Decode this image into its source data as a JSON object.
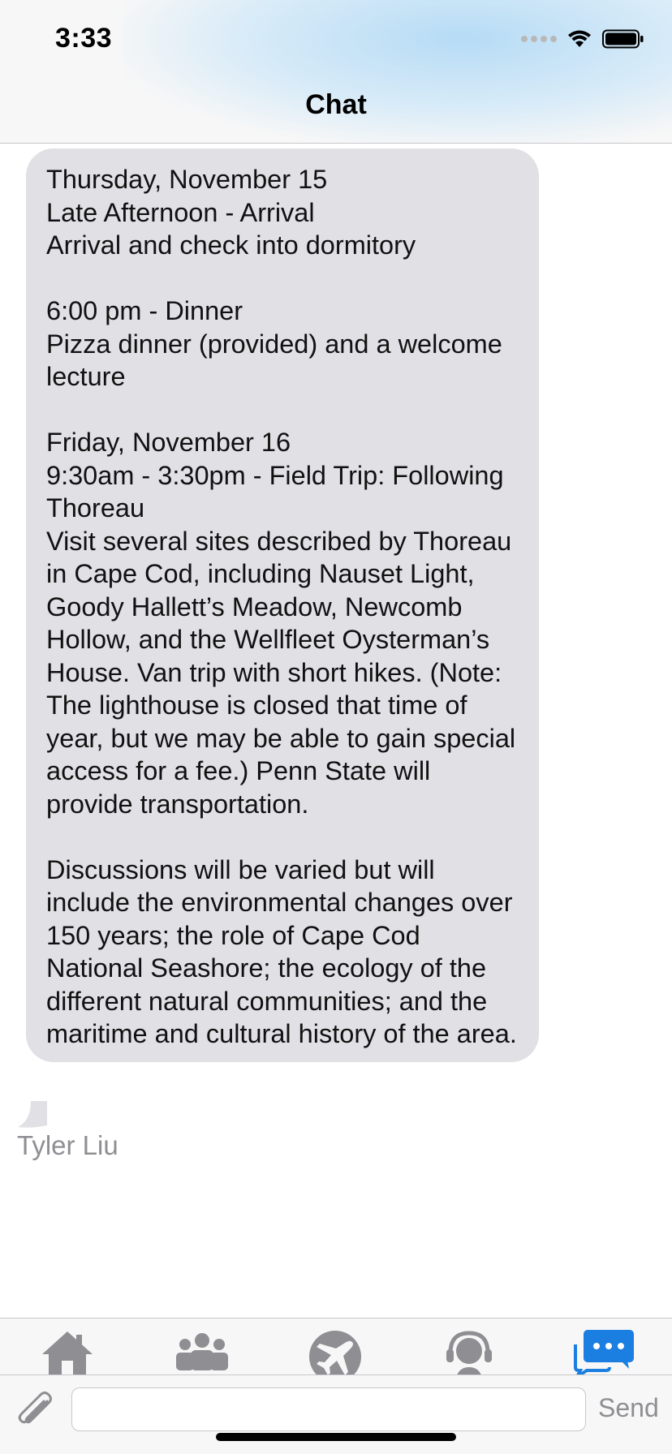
{
  "status_bar": {
    "time": "3:33"
  },
  "nav": {
    "title": "Chat"
  },
  "message": {
    "text": "Thursday, November 15\nLate Afternoon - Arrival\nArrival and check into dormitory\n\n6:00 pm - Dinner\nPizza dinner (provided) and a welcome lecture\n\nFriday, November 16\n9:30am - 3:30pm - Field Trip: Following Thoreau\nVisit several sites described by Thoreau in Cape Cod, including Nauset Light, Goody Hallett’s Meadow, Newcomb Hollow, and the Wellfleet Oysterman’s House. Van trip with short hikes. (Note: The lighthouse is closed that time of year, but we may be able to gain special access for a fee.) Penn State will provide transportation.\n\nDiscussions will be varied but will include the environmental changes over 150 years; the role of Cape Cod National Seashore; the ecology of the different natural communities; and the maritime and cultural history of the area.",
    "sender": "Tyler Liu"
  },
  "tabbar": {
    "tabs": [
      {
        "icon": "home-icon",
        "active": false
      },
      {
        "icon": "people-icon",
        "active": false
      },
      {
        "icon": "airplane-icon",
        "active": false
      },
      {
        "icon": "support-headset-icon",
        "active": false
      },
      {
        "icon": "chat-icon",
        "active": true
      }
    ],
    "active_color": "#1a7fe0",
    "inactive_color": "#8e8e93"
  },
  "composer": {
    "input_value": "",
    "send_label": "Send"
  },
  "colors": {
    "bubble": "#e0e0e5",
    "header_glow": "#bfe0f6"
  }
}
